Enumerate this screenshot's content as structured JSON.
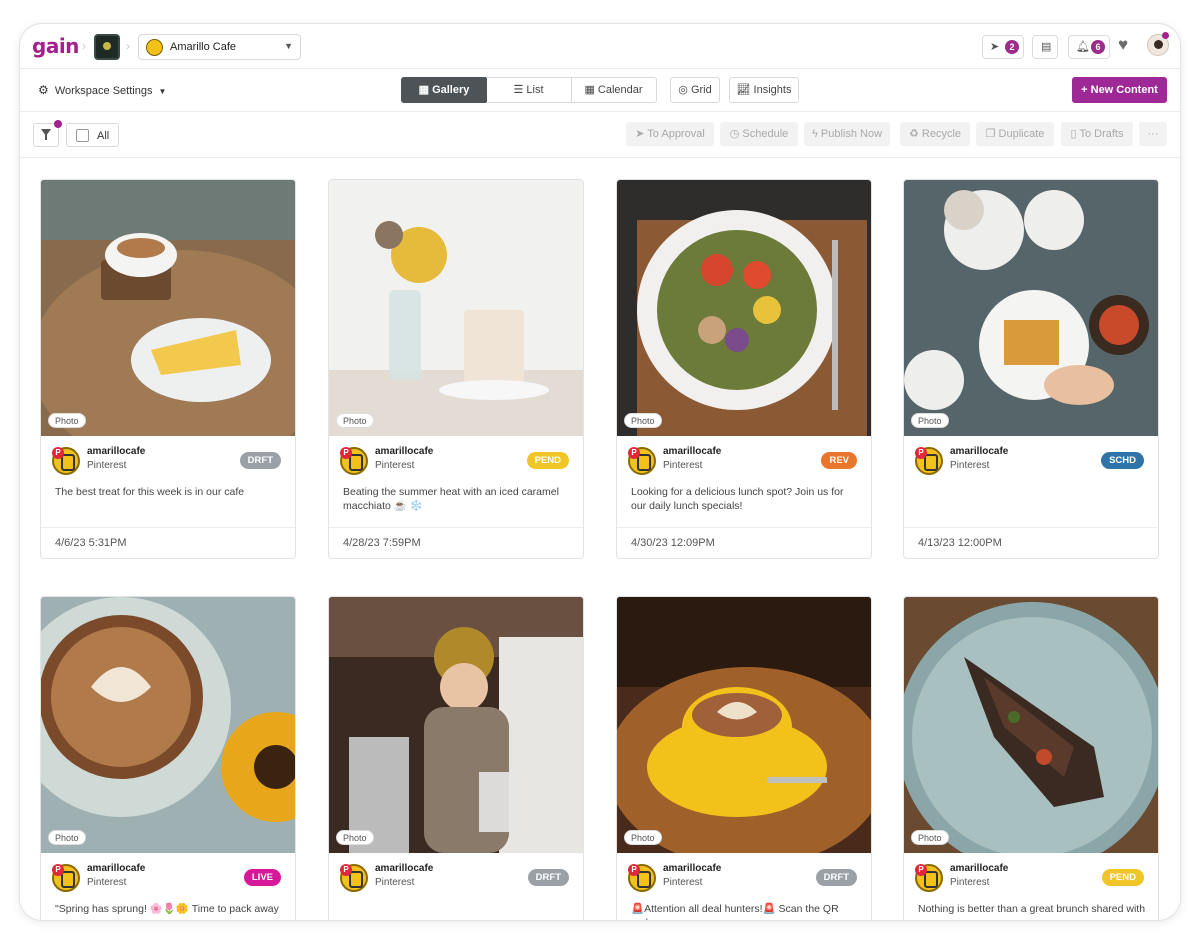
{
  "header": {
    "logo": "gain",
    "workspace_name": "Amarillo Cafe",
    "send_count": "2",
    "notif_count": "6"
  },
  "toolbar": {
    "workspace_settings": "Workspace Settings",
    "views": [
      "Gallery",
      "List",
      "Calendar"
    ],
    "grid_label": "Grid",
    "insights_label": "Insights",
    "new_content": "+ New Content"
  },
  "filters": {
    "all_label": "All",
    "actions": [
      "To Approval",
      "Schedule",
      "Publish Now",
      "Recycle",
      "Duplicate",
      "To Drafts",
      "···"
    ]
  },
  "colors": {
    "brand": "#a3208d",
    "status": {
      "DRFT": "#9aa0a6",
      "PEND": "#f0c528",
      "REV": "#e8762d",
      "SCHD": "#2e74a8",
      "LIVE": "#d8189a"
    }
  },
  "posts": [
    {
      "type": "Photo",
      "account": "amarillocafe",
      "platform": "Pinterest",
      "status": "DRFT",
      "caption": "The best treat for this week is in our cafe",
      "date": "4/6/23 5:31PM"
    },
    {
      "type": "Photo",
      "account": "amarillocafe",
      "platform": "Pinterest",
      "status": "PEND",
      "caption": "Beating the summer heat with an iced caramel macchiato ☕ ❄️",
      "date": "4/28/23 7:59PM"
    },
    {
      "type": "Photo",
      "account": "amarillocafe",
      "platform": "Pinterest",
      "status": "REV",
      "caption": "Looking for a delicious lunch spot? Join us for our daily lunch specials!",
      "date": "4/30/23 12:09PM"
    },
    {
      "type": "Photo",
      "account": "amarillocafe",
      "platform": "Pinterest",
      "status": "SCHD",
      "caption": "",
      "date": "4/13/23 12:00PM"
    },
    {
      "type": "Photo",
      "account": "amarillocafe",
      "platform": "Pinterest",
      "status": "LIVE",
      "caption": "\"Spring has sprung! 🌸🌷🌼 Time to pack away",
      "date": ""
    },
    {
      "type": "Photo",
      "account": "amarillocafe",
      "platform": "Pinterest",
      "status": "DRFT",
      "caption": "",
      "date": ""
    },
    {
      "type": "Photo",
      "account": "amarillocafe",
      "platform": "Pinterest",
      "status": "DRFT",
      "caption": "🚨Attention all deal hunters!🚨 Scan the QR code",
      "date": ""
    },
    {
      "type": "Photo",
      "account": "amarillocafe",
      "platform": "Pinterest",
      "status": "PEND",
      "caption": "Nothing is better than a great brunch shared with",
      "date": ""
    }
  ]
}
